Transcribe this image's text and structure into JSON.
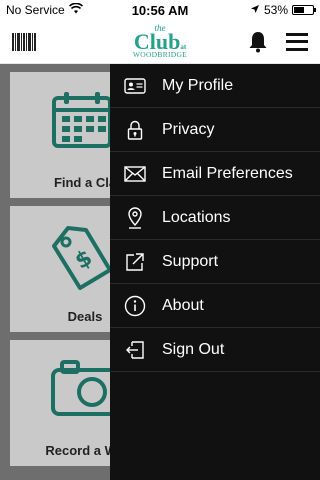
{
  "status_bar": {
    "carrier": "No Service",
    "time": "10:56 AM",
    "battery": "53%",
    "battery_level": 0.53
  },
  "header": {
    "logo_the": "the",
    "logo_club": "Club",
    "logo_at": "at",
    "logo_sub": "WOODBRIDGE",
    "brand_color": "#28a08e",
    "barcode_icon": "barcode-icon",
    "bell_icon": "bell-icon",
    "menu_icon": "hamburger-menu-icon"
  },
  "tiles": [
    {
      "label": "Find a Cla",
      "icon": "calendar-icon"
    },
    {
      "label": "Deals",
      "icon": "tag-icon"
    },
    {
      "label": "Record a Wo",
      "icon": "camera-icon"
    }
  ],
  "menu": {
    "items": [
      {
        "label": "My Profile",
        "icon": "id-card-icon"
      },
      {
        "label": "Privacy",
        "icon": "lock-icon"
      },
      {
        "label": "Email Preferences",
        "icon": "envelope-icon"
      },
      {
        "label": "Locations",
        "icon": "location-pin-icon"
      },
      {
        "label": "Support",
        "icon": "external-link-icon"
      },
      {
        "label": "About",
        "icon": "info-icon"
      },
      {
        "label": "Sign Out",
        "icon": "sign-out-icon"
      }
    ]
  }
}
